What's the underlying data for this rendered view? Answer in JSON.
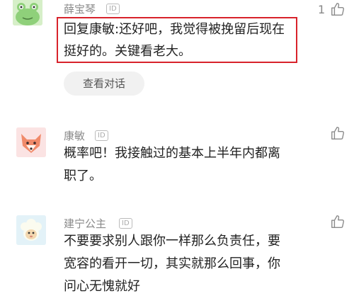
{
  "comments": [
    {
      "username": "薛宝琴",
      "id_badge": "ID",
      "like_count": "1",
      "reply_line1": "回复康敏:还好吧，我觉得被挽留后现在",
      "reply_line2": "挺好的。关键看老大。",
      "view_conversation": "查看对话",
      "avatar_icon": "frog-icon"
    },
    {
      "username": "康敏",
      "id_badge": "ID",
      "line1": "概率吧！我接触过的基本上半年内都离",
      "line2": "职了。",
      "avatar_icon": "fox-icon"
    },
    {
      "username": "建宁公主",
      "id_badge": "ID",
      "line1": "不要要求别人跟你一样那么负责任，要",
      "line2": "宽容的看开一切，其实就那么回事，你",
      "line3": "问心无愧就好",
      "avatar_icon": "sheep-icon"
    }
  ],
  "colors": {
    "highlight_border": "#d8222b",
    "username": "#8a8a8a",
    "pill_bg": "#f1f1f1"
  }
}
